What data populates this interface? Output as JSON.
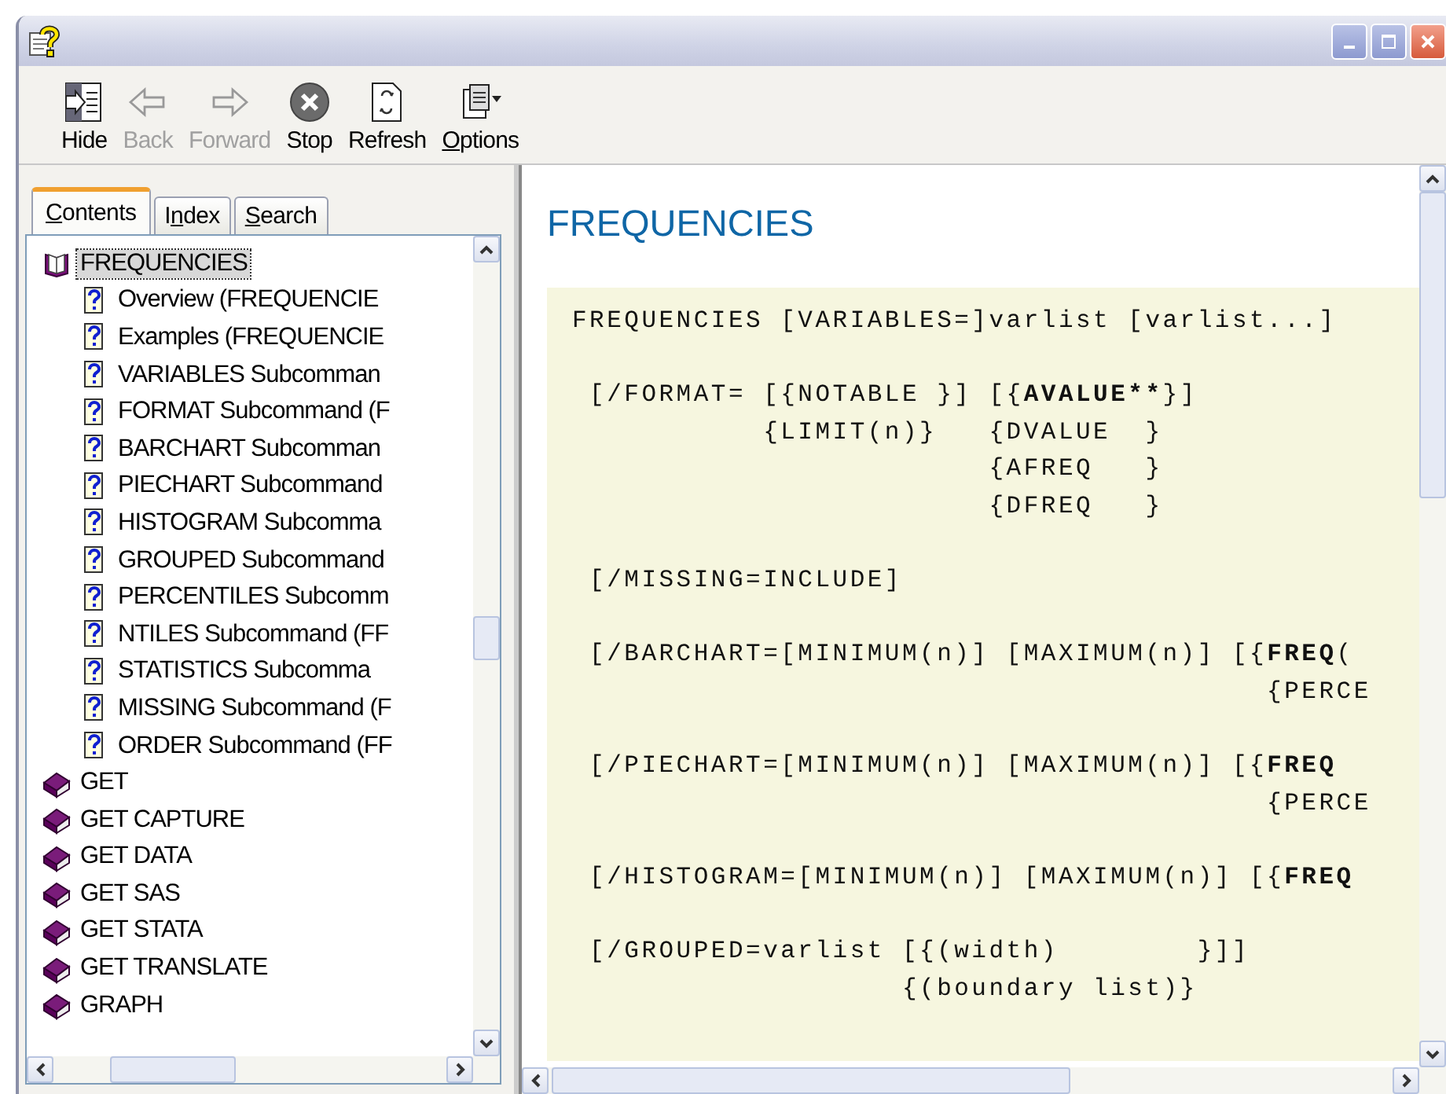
{
  "toolbar": [
    {
      "kind": "hide",
      "label": "Hide",
      "disabled": false
    },
    {
      "kind": "back",
      "label": "Back",
      "disabled": true
    },
    {
      "kind": "forward",
      "label": "Forward",
      "disabled": true
    },
    {
      "kind": "stop",
      "label": "Stop",
      "disabled": false
    },
    {
      "kind": "refresh",
      "label": "Refresh",
      "disabled": false
    },
    {
      "kind": "options",
      "access_key": "O",
      "label_end": "ptions",
      "disabled": false
    }
  ],
  "nav_tabs": [
    {
      "access_key": "C",
      "label_end": "ontents",
      "selected": true
    },
    {
      "label_start": "I",
      "access_key": "n",
      "label_end": "dex",
      "selected": false
    },
    {
      "access_key": "S",
      "label_end": "earch",
      "selected": false
    }
  ],
  "tree": [
    {
      "label": "FREQUENCIES",
      "kind": "book",
      "expanded": true,
      "selected": true,
      "children": [
        {
          "label": "Overview (FREQUENCIE",
          "kind": "topic",
          "selected": false
        },
        {
          "label": "Examples (FREQUENCIE",
          "kind": "topic",
          "selected": false
        },
        {
          "label": "VARIABLES Subcomman",
          "kind": "topic",
          "selected": false
        },
        {
          "label": "FORMAT Subcommand (F",
          "kind": "topic",
          "selected": false
        },
        {
          "label": "BARCHART Subcomman",
          "kind": "topic",
          "selected": false
        },
        {
          "label": "PIECHART Subcommand",
          "kind": "topic",
          "selected": false
        },
        {
          "label": "HISTOGRAM Subcomma",
          "kind": "topic",
          "selected": false
        },
        {
          "label": "GROUPED Subcommand",
          "kind": "topic",
          "selected": false
        },
        {
          "label": "PERCENTILES Subcomm",
          "kind": "topic",
          "selected": false
        },
        {
          "label": "NTILES Subcommand (FF",
          "kind": "topic",
          "selected": false
        },
        {
          "label": "STATISTICS Subcomma",
          "kind": "topic",
          "selected": false
        },
        {
          "label": "MISSING Subcommand (F",
          "kind": "topic",
          "selected": false
        },
        {
          "label": "ORDER Subcommand (FF",
          "kind": "topic",
          "selected": false
        }
      ]
    },
    {
      "label": "GET",
      "kind": "book",
      "expanded": false,
      "selected": false
    },
    {
      "label": "GET CAPTURE",
      "kind": "book",
      "expanded": false,
      "selected": false
    },
    {
      "label": "GET DATA",
      "kind": "book",
      "expanded": false,
      "selected": false
    },
    {
      "label": "GET SAS",
      "kind": "book",
      "expanded": false,
      "selected": false
    },
    {
      "label": "GET STATA",
      "kind": "book",
      "expanded": false,
      "selected": false
    },
    {
      "label": "GET TRANSLATE",
      "kind": "book",
      "expanded": false,
      "selected": false
    },
    {
      "label": "GRAPH",
      "kind": "book",
      "expanded": false,
      "selected": false
    }
  ],
  "page": {
    "title": "FREQUENCIES",
    "syntax": [
      [
        [
          {
            "text": "FREQUENCIES [VARIABLES=]varlist [varlist...]",
            "bold": false
          }
        ]
      ],
      [
        [
          {
            "text": " [/FORMAT= [{NOTABLE }] [{",
            "bold": false
          },
          {
            "text": "AVALUE**",
            "bold": true
          },
          {
            "text": "}]",
            "bold": false
          }
        ],
        [
          {
            "text": "           {LIMIT(n)}   {DVALUE  }",
            "bold": false
          }
        ],
        [
          {
            "text": "                        {AFREQ   }",
            "bold": false
          }
        ],
        [
          {
            "text": "                        {DFREQ   }",
            "bold": false
          }
        ]
      ],
      [
        [
          {
            "text": " [/MISSING=INCLUDE]",
            "bold": false
          }
        ]
      ],
      [
        [
          {
            "text": " [/BARCHART=[MINIMUM(n)] [MAXIMUM(n)] [{",
            "bold": false
          },
          {
            "text": "FREQ",
            "bold": true
          },
          {
            "text": "(",
            "bold": false
          }
        ],
        [
          {
            "text": "                                        {PERCE",
            "bold": false
          }
        ]
      ],
      [
        [
          {
            "text": " [/PIECHART=[MINIMUM(n)] [MAXIMUM(n)] [{",
            "bold": false
          },
          {
            "text": "FREQ",
            "bold": true
          }
        ],
        [
          {
            "text": "                                        {PERCE",
            "bold": false
          }
        ]
      ],
      [
        [
          {
            "text": " [/HISTOGRAM=[MINIMUM(n)] [MAXIMUM(n)] [{",
            "bold": false
          },
          {
            "text": "FREQ",
            "bold": true
          }
        ]
      ],
      [
        [
          {
            "text": " [/GROUPED=varlist [{(width)        }]]",
            "bold": false
          }
        ],
        [
          {
            "text": "                   {(boundary list)}",
            "bold": false
          }
        ]
      ]
    ]
  }
}
